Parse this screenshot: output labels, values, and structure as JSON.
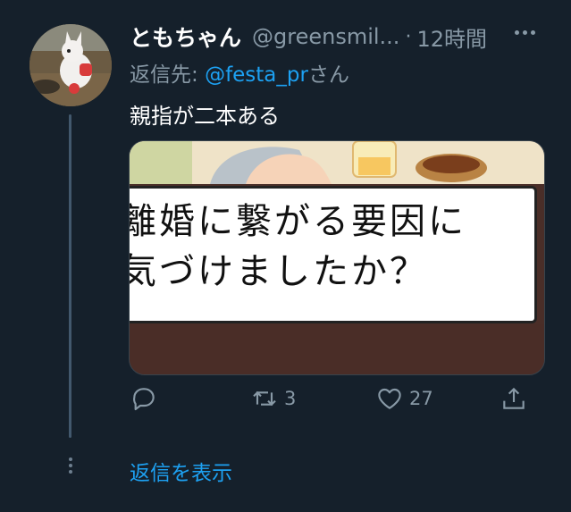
{
  "tweet": {
    "display_name": "ともちゃん",
    "handle": "@greensmil...",
    "separator": "·",
    "time": "12時間",
    "reply_prefix": "返信先: ",
    "reply_handle": "@festa_pr",
    "reply_suffix": "さん",
    "text": "親指が二本ある",
    "media_caption": "離婚に繋がる要因に\n気づけましたか？"
  },
  "actions": {
    "retweet_count": "3",
    "like_count": "27"
  },
  "thread": {
    "show_replies_label": "返信を表示"
  },
  "icons": {
    "reply": "reply-icon",
    "retweet": "retweet-icon",
    "like": "heart-icon",
    "share": "share-icon",
    "more": "more-icon"
  },
  "colors": {
    "background": "#15202b",
    "accent": "#1da1f2",
    "muted": "#8899a6"
  }
}
